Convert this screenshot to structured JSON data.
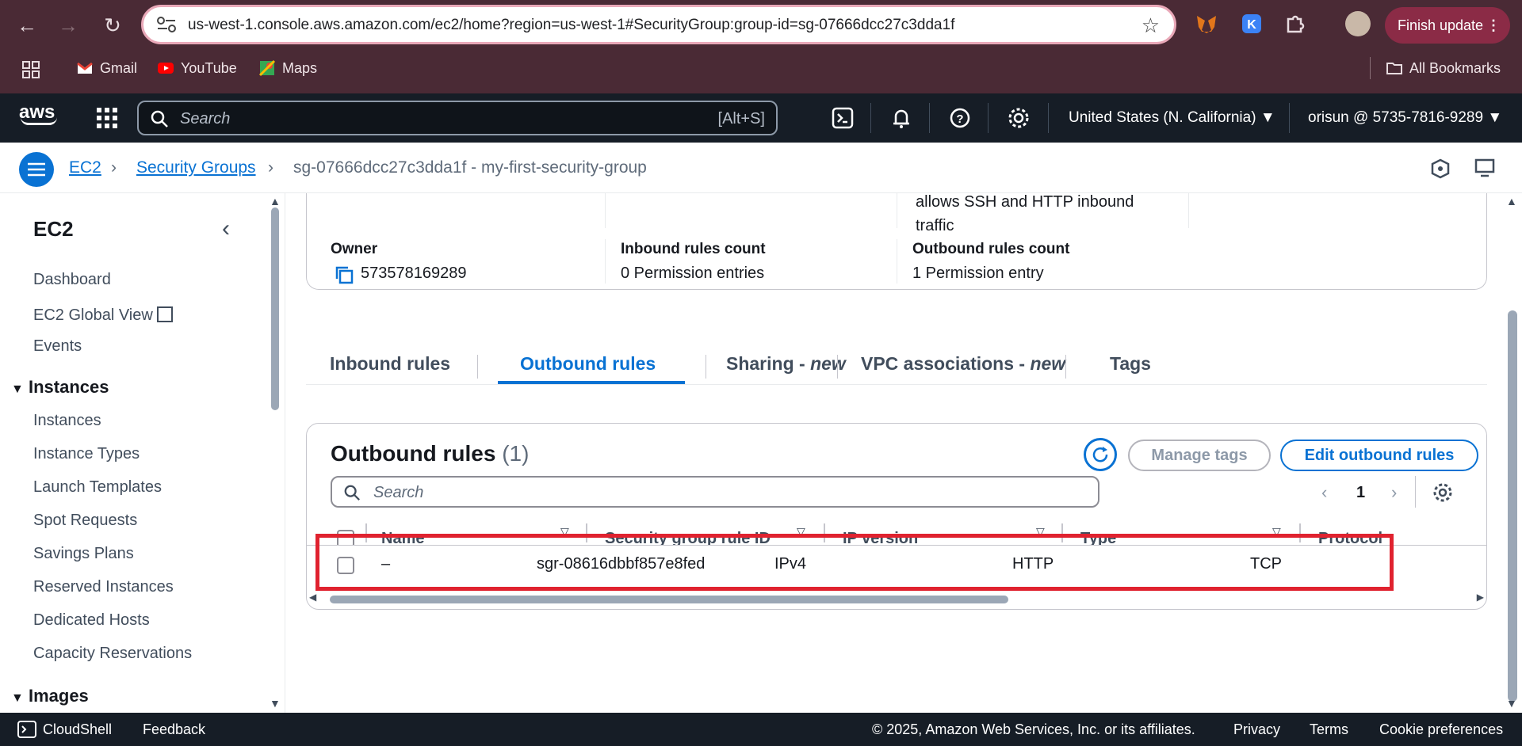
{
  "browser": {
    "url": "us-west-1.console.aws.amazon.com/ec2/home?region=us-west-1#SecurityGroup:group-id=sg-07666dcc27c3dda1f",
    "finish_update": "Finish update",
    "bookmarks": [
      "Gmail",
      "YouTube",
      "Maps"
    ],
    "all_bookmarks": "All Bookmarks"
  },
  "aws": {
    "logo": "aws",
    "search_placeholder": "Search",
    "search_shortcut": "[Alt+S]",
    "region": "United States (N. California) ▼",
    "account": "orisun @ 5735-7816-9289 ▼"
  },
  "breadcrumb": {
    "ec2": "EC2",
    "security_groups": "Security Groups",
    "current": "sg-07666dcc27c3dda1f - my-first-security-group"
  },
  "sidebar": {
    "title": "EC2",
    "items_top": [
      "Dashboard",
      "EC2 Global View",
      "Events"
    ],
    "section_instances": "Instances",
    "items_instances": [
      "Instances",
      "Instance Types",
      "Launch Templates",
      "Spot Requests",
      "Savings Plans",
      "Reserved Instances",
      "Dedicated Hosts",
      "Capacity Reservations"
    ],
    "section_images": "Images"
  },
  "details": {
    "description_line1": "allows SSH and HTTP inbound",
    "description_line2": "traffic",
    "owner_label": "Owner",
    "owner_value": "573578169289",
    "inbound_label": "Inbound rules count",
    "inbound_value": "0 Permission entries",
    "outbound_label": "Outbound rules count",
    "outbound_value": "1 Permission entry"
  },
  "tabs": {
    "inbound": "Inbound rules",
    "outbound": "Outbound rules",
    "sharing": "Sharing - ",
    "sharing_new": "new",
    "vpc": "VPC associations - ",
    "vpc_new": "new",
    "tags": "Tags"
  },
  "rules": {
    "title": "Outbound rules",
    "count": "(1)",
    "manage_tags": "Manage tags",
    "edit": "Edit outbound rules",
    "search_placeholder": "Search",
    "page": "1",
    "columns": [
      "Name",
      "Security group rule ID",
      "IP version",
      "Type",
      "Protocol"
    ],
    "row": {
      "name": "–",
      "rule_id": "sgr-08616dbbf857e8fed",
      "ip_version": "IPv4",
      "type": "HTTP",
      "protocol": "TCP"
    }
  },
  "footer": {
    "cloudshell": "CloudShell",
    "feedback": "Feedback",
    "copyright": "© 2025, Amazon Web Services, Inc. or its affiliates.",
    "privacy": "Privacy",
    "terms": "Terms",
    "cookies": "Cookie preferences"
  },
  "colors": {
    "accent": "#0972d3",
    "highlight": "#e0222f",
    "browser_frame": "#4a2a35",
    "aws_nav": "#161d26"
  }
}
